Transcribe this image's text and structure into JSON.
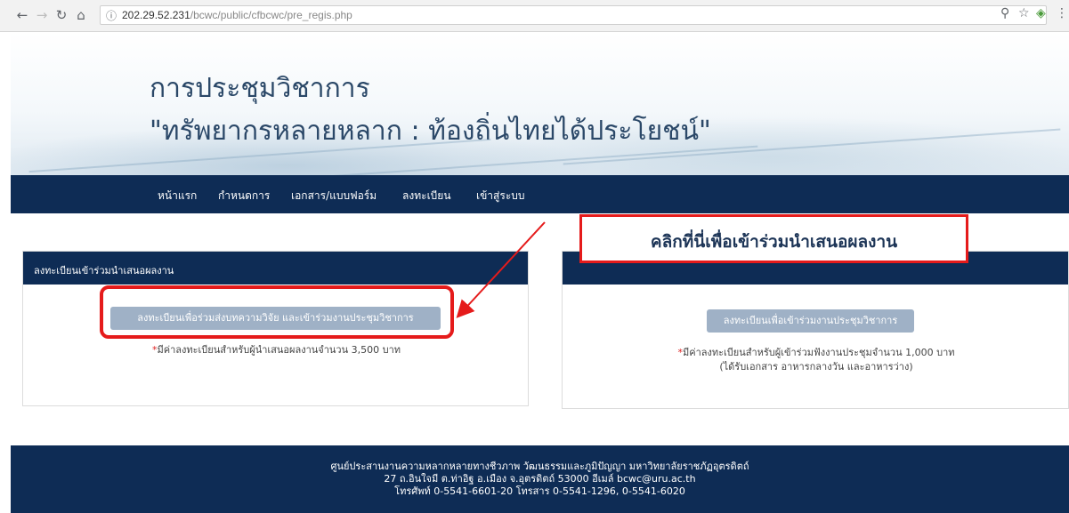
{
  "browser": {
    "url_host": "202.29.52.231",
    "url_path": "/bcwc/public/cfbcwc/pre_regis.php"
  },
  "banner": {
    "title_line1": "การประชุมวิชาการ",
    "title_line2": "\"ทรัพยากรหลายหลาก : ท้องถิ่นไทยได้ประโยชน์\""
  },
  "nav": {
    "items": [
      "หน้าแรก",
      "กำหนดการ",
      "เอกสาร/แบบฟอร์ม",
      "ลงทะเบียน",
      "เข้าสู่ระบบ"
    ]
  },
  "card_left": {
    "header": "ลงทะเบียนเข้าร่วมนำเสนอผลงาน",
    "button": "ลงทะเบียนเพื่อร่วมส่งบทความวิจัย และเข้าร่วมงานประชุมวิชาการ",
    "note_star": "*",
    "note": "มีค่าลงทะเบียนสำหรับผู้นำเสนอผลงานจำนวน 3,500 บาท"
  },
  "card_right": {
    "button": "ลงทะเบียนเพื่อเข้าร่วมงานประชุมวิชาการ",
    "note_star": "*",
    "note_line1": "มีค่าลงทะเบียนสำหรับผู้เข้าร่วมฟังงานประชุมจำนวน 1,000 บาท",
    "note_line2": "(ได้รับเอกสาร อาหารกลางวัน และอาหารว่าง)"
  },
  "callout": {
    "text": "คลิกที่นี่เพื่อเข้าร่วมนำเสนอผลงาน"
  },
  "footer": {
    "line1": "ศูนย์ประสานงานความหลากหลายทางชีวภาพ วัฒนธรรมและภูมิปัญญา มหาวิทยาลัยราชภัฏอุตรดิตถ์",
    "line2": "27 ถ.อินใจมี ต.ท่าอิฐ อ.เมือง จ.อุตรดิตถ์ 53000 อีเมล์ bcwc@uru.ac.th",
    "line3": "โทรศัพท์ 0-5541-6601-20 โทรสาร 0-5541-1296, 0-5541-6020"
  },
  "colors": {
    "navy": "#0e2c55",
    "button": "#9fb1c6",
    "highlight_red": "#e51b1b"
  }
}
